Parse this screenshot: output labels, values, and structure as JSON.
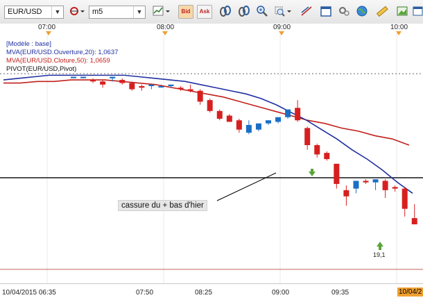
{
  "toolbar": {
    "symbol": "EUR/USD",
    "timeframe": "m5",
    "bid_label": "Bid",
    "ask_label": "Ask"
  },
  "time_axis_top": [
    "07:00",
    "08:00",
    "09:00",
    "10:00"
  ],
  "legend": {
    "model": "[Modèle : base]",
    "mva_open": "MVA(EUR/USD.Ouverture,20): 1,0637",
    "mva_close": "MVA(EUR/USD.Cloture,50): 1,0659",
    "pivot": "PIVOT(EUR/USD,Pivot)"
  },
  "annotation": "cassure du + bas d'hier",
  "marker_label": "19,1",
  "time_axis_bottom": {
    "start": "10/04/2015 06:35",
    "labels": [
      "07:50",
      "08:25",
      "09:00",
      "09:35"
    ],
    "current": "10/04/2"
  },
  "colors": {
    "up": "#1a6fc4",
    "down": "#d62020",
    "mva_open": "#1f2fa0",
    "mva_close": "#c0201a",
    "level_line": "#000000",
    "bottom_line": "#c86060",
    "accent": "#f0a030"
  },
  "chart_data": {
    "type": "candlestick",
    "series": [
      {
        "o": 80,
        "h": 80,
        "l": 80,
        "c": 80
      },
      {
        "o": 80,
        "h": 80,
        "l": 80,
        "c": 80
      },
      {
        "o": 78,
        "h": 79,
        "l": 76,
        "c": 77
      },
      {
        "o": 77,
        "h": 78,
        "l": 73,
        "c": 75
      },
      {
        "o": 79,
        "h": 80,
        "l": 77,
        "c": 80
      },
      {
        "o": 78,
        "h": 79,
        "l": 75,
        "c": 76
      },
      {
        "o": 76,
        "h": 77,
        "l": 71,
        "c": 72
      },
      {
        "o": 74,
        "h": 75,
        "l": 71,
        "c": 73
      },
      {
        "o": 74,
        "h": 75,
        "l": 72,
        "c": 75
      },
      {
        "o": 74,
        "h": 75,
        "l": 73,
        "c": 74
      },
      {
        "o": 74,
        "h": 75,
        "l": 73,
        "c": 75
      },
      {
        "o": 73,
        "h": 74,
        "l": 71,
        "c": 72
      },
      {
        "o": 72,
        "h": 75,
        "l": 70,
        "c": 71
      },
      {
        "o": 71,
        "h": 72,
        "l": 62,
        "c": 64
      },
      {
        "o": 65,
        "h": 66,
        "l": 57,
        "c": 58
      },
      {
        "o": 58,
        "h": 59,
        "l": 52,
        "c": 53
      },
      {
        "o": 55,
        "h": 56,
        "l": 51,
        "c": 51
      },
      {
        "o": 52,
        "h": 53,
        "l": 44,
        "c": 46
      },
      {
        "o": 44,
        "h": 52,
        "l": 43,
        "c": 49
      },
      {
        "o": 46,
        "h": 50,
        "l": 45,
        "c": 50
      },
      {
        "o": 50,
        "h": 52,
        "l": 49,
        "c": 52
      },
      {
        "o": 51,
        "h": 54,
        "l": 50,
        "c": 54
      },
      {
        "o": 54,
        "h": 59,
        "l": 53,
        "c": 59
      },
      {
        "o": 60,
        "h": 65,
        "l": 51,
        "c": 52
      },
      {
        "o": 47,
        "h": 48,
        "l": 33,
        "c": 36
      },
      {
        "o": 36,
        "h": 37,
        "l": 28,
        "c": 30
      },
      {
        "o": 31,
        "h": 32,
        "l": 26,
        "c": 27
      },
      {
        "o": 24,
        "h": 24,
        "l": 8,
        "c": 11
      },
      {
        "o": 7,
        "h": 10,
        "l": -3,
        "c": 3
      },
      {
        "o": 8,
        "h": 13,
        "l": 5,
        "c": 13
      },
      {
        "o": 13,
        "h": 14,
        "l": 11,
        "c": 12
      },
      {
        "o": 12,
        "h": 14,
        "l": 7,
        "c": 14
      },
      {
        "o": 13,
        "h": 14,
        "l": 2,
        "c": 7
      },
      {
        "o": 9,
        "h": 10,
        "l": 6,
        "c": 8
      },
      {
        "o": 8,
        "h": 9,
        "l": -10,
        "c": -5
      },
      {
        "o": -11,
        "h": -2,
        "l": -15,
        "c": -15
      },
      {
        "o": -18,
        "h": -18,
        "l": -30,
        "c": -26
      },
      {
        "o": -27,
        "h": -25,
        "l": -35,
        "c": -32
      },
      {
        "o": -23,
        "h": -20,
        "l": -32,
        "c": -32
      },
      {
        "o": -30,
        "h": -17,
        "l": -30,
        "c": -21
      },
      {
        "o": -20,
        "h": -18,
        "l": -21,
        "c": -19
      }
    ],
    "mva_open": [
      78,
      79,
      80,
      81,
      81,
      81,
      81,
      81,
      81,
      80,
      79,
      78,
      77,
      75,
      73,
      71,
      69,
      66,
      62,
      57,
      52,
      46,
      40,
      33,
      27,
      20,
      12,
      5
    ],
    "mva_close": [
      76,
      76,
      77,
      77,
      78,
      78,
      78,
      77,
      76,
      75,
      73,
      71,
      69,
      67,
      64,
      61,
      58,
      55,
      52,
      50,
      47,
      45,
      42,
      40,
      36
    ],
    "pivot_level": 82,
    "support_level": 15,
    "lower_level": -44,
    "ylim": [
      -53,
      108
    ]
  }
}
